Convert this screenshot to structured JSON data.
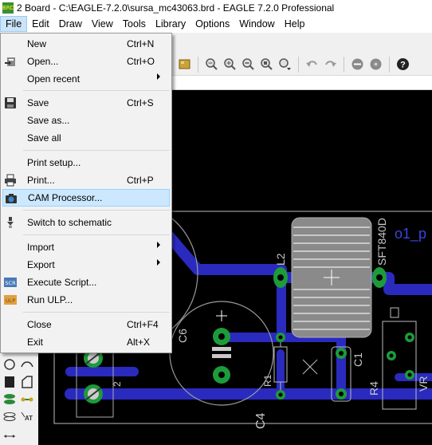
{
  "window": {
    "app_icon_text": "BRD",
    "title": "2 Board - C:\\EAGLE-7.2.0\\sursa_mc43063.brd - EAGLE 7.2.0 Professional"
  },
  "menubar": {
    "items": [
      "File",
      "Edit",
      "Draw",
      "View",
      "Tools",
      "Library",
      "Options",
      "Window",
      "Help"
    ],
    "active": "File"
  },
  "file_menu": {
    "items": [
      {
        "label": "New",
        "shortcut": "Ctrl+N",
        "icon": ""
      },
      {
        "label": "Open...",
        "shortcut": "Ctrl+O",
        "icon": "open-icon"
      },
      {
        "label": "Open recent",
        "shortcut": "",
        "icon": "",
        "submenu": true
      },
      {
        "label": "Save",
        "shortcut": "Ctrl+S",
        "icon": "save-icon"
      },
      {
        "label": "Save as...",
        "shortcut": "",
        "icon": ""
      },
      {
        "label": "Save all",
        "shortcut": "",
        "icon": ""
      },
      {
        "label": "Print setup...",
        "shortcut": "",
        "icon": ""
      },
      {
        "label": "Print...",
        "shortcut": "Ctrl+P",
        "icon": "printer-icon"
      },
      {
        "label": "CAM Processor...",
        "shortcut": "",
        "icon": "cam-icon",
        "highlighted": true
      },
      {
        "label": "Switch to schematic",
        "shortcut": "",
        "icon": "switch-icon"
      },
      {
        "label": "Import",
        "shortcut": "",
        "icon": "",
        "submenu": true
      },
      {
        "label": "Export",
        "shortcut": "",
        "icon": "",
        "submenu": true
      },
      {
        "label": "Execute Script...",
        "shortcut": "",
        "icon": "script-icon",
        "icon_text": "SCR"
      },
      {
        "label": "Run ULP...",
        "shortcut": "",
        "icon": "ulp-icon",
        "icon_text": "ULP"
      },
      {
        "label": "Close",
        "shortcut": "Ctrl+F4",
        "icon": ""
      },
      {
        "label": "Exit",
        "shortcut": "Alt+X",
        "icon": ""
      }
    ]
  },
  "toolbar": {
    "icons": [
      "layer-icon",
      "zoom-fit-icon",
      "zoom-in-icon",
      "zoom-out-icon",
      "zoom-select-icon",
      "zoom-dropdown-icon",
      "undo-icon",
      "redo-icon",
      "stop-icon",
      "go-icon",
      "help-icon"
    ]
  },
  "board": {
    "labels": {
      "c6": "C6",
      "l2": "L2",
      "sft": "SFT840D",
      "o1": "o1_p",
      "c1": "C1",
      "r1": "R1",
      "r4": "R4",
      "vr": "VR",
      "c4": "C4",
      "pin2": "2"
    }
  },
  "colors": {
    "canvas": "#000000",
    "trace": "#2a2abf",
    "pad": "#1d9b3a",
    "silkscreen": "#c8c8c8",
    "label_blue": "#3a44e0",
    "menu_highlight": "#cce8ff"
  }
}
